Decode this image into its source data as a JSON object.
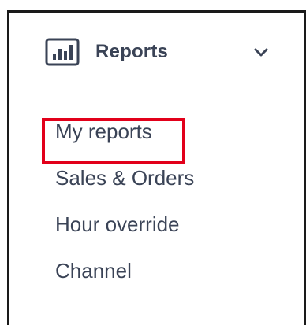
{
  "sidebar": {
    "section": {
      "icon": "bar-chart-icon",
      "title": "Reports",
      "toggle_icon": "chevron-down-icon"
    },
    "items": [
      {
        "label": "My reports",
        "highlighted": true
      },
      {
        "label": "Sales & Orders"
      },
      {
        "label": "Hour override"
      },
      {
        "label": "Channel"
      }
    ]
  },
  "colors": {
    "text": "#3a4356",
    "highlight": "#e2001a",
    "border": "#1a1a1a"
  }
}
